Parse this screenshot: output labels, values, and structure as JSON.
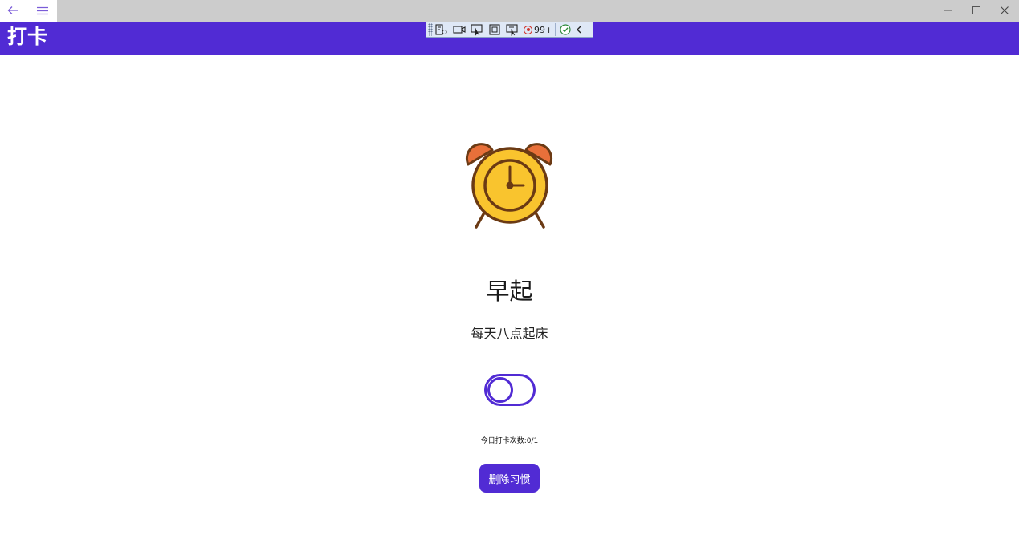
{
  "window": {
    "back_icon": "back-arrow-icon",
    "menu_icon": "hamburger-menu-icon",
    "minimize_icon": "minimize-icon",
    "maximize_icon": "maximize-icon",
    "close_icon": "close-icon"
  },
  "app_bar": {
    "title": "打卡",
    "color": "#512bd4"
  },
  "debug_toolbar": {
    "badge_count": "99+",
    "icons": [
      "live-visual-tree-icon",
      "record-icon",
      "select-element-icon",
      "display-layout-adorners-icon",
      "track-focus-icon",
      "binding-failures-icon",
      "hot-reload-check-icon",
      "collapse-chevron-icon"
    ]
  },
  "habit": {
    "icon": "alarm-clock-icon",
    "title": "早起",
    "description": "每天八点起床",
    "toggle_on": false,
    "checkin_label": "今日打卡次数:0/1",
    "delete_label": "删除习惯"
  },
  "colors": {
    "accent": "#512bd4",
    "clock_body": "#f9c42e",
    "clock_bells": "#e8703a",
    "clock_outline": "#6b3a14"
  }
}
